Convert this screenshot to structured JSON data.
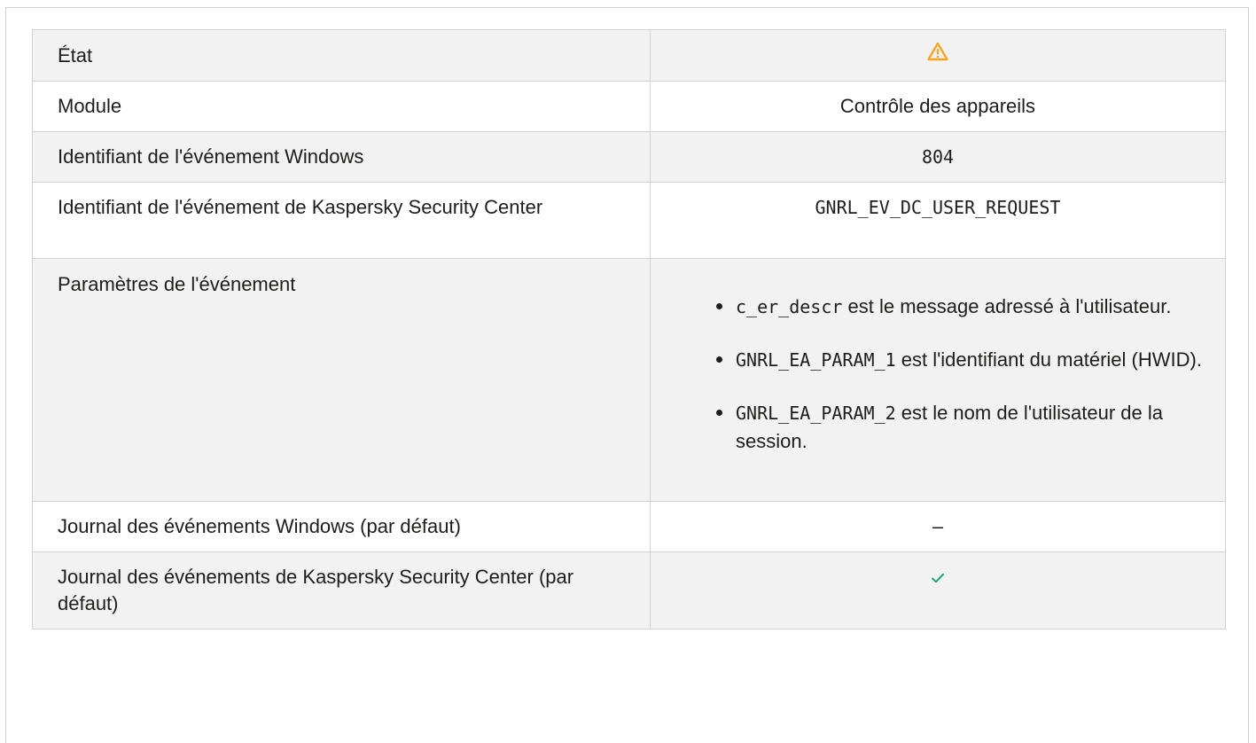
{
  "table": {
    "rows": {
      "state": {
        "label": "État",
        "value_icon": "warning-icon"
      },
      "module": {
        "label": "Module",
        "value": "Contrôle des appareils"
      },
      "windows_event_id": {
        "label": "Identifiant de l'événement Windows",
        "value": "804"
      },
      "ksc_event_id": {
        "label": "Identifiant de l'événement de Kaspersky Security Center",
        "value": "GNRL_EV_DC_USER_REQUEST"
      },
      "event_params": {
        "label": "Paramètres de l'événement",
        "items": [
          {
            "code": "c_er_descr",
            "text": " est le message adressé à l'utilisateur."
          },
          {
            "code": "GNRL_EA_PARAM_1",
            "text": " est l'identifiant du matériel (HWID)."
          },
          {
            "code": "GNRL_EA_PARAM_2",
            "text": " est le nom de l'utilisateur de la session."
          }
        ]
      },
      "windows_log": {
        "label": "Journal des événements Windows (par défaut)",
        "value": "–"
      },
      "ksc_log": {
        "label": "Journal des événements de Kaspersky Security Center (par défaut)",
        "value_icon": "check-icon"
      }
    }
  },
  "colors": {
    "warning": "#f5a623",
    "check": "#1aa37a",
    "border": "#d2d2d2",
    "row_alt": "#f2f2f2"
  }
}
